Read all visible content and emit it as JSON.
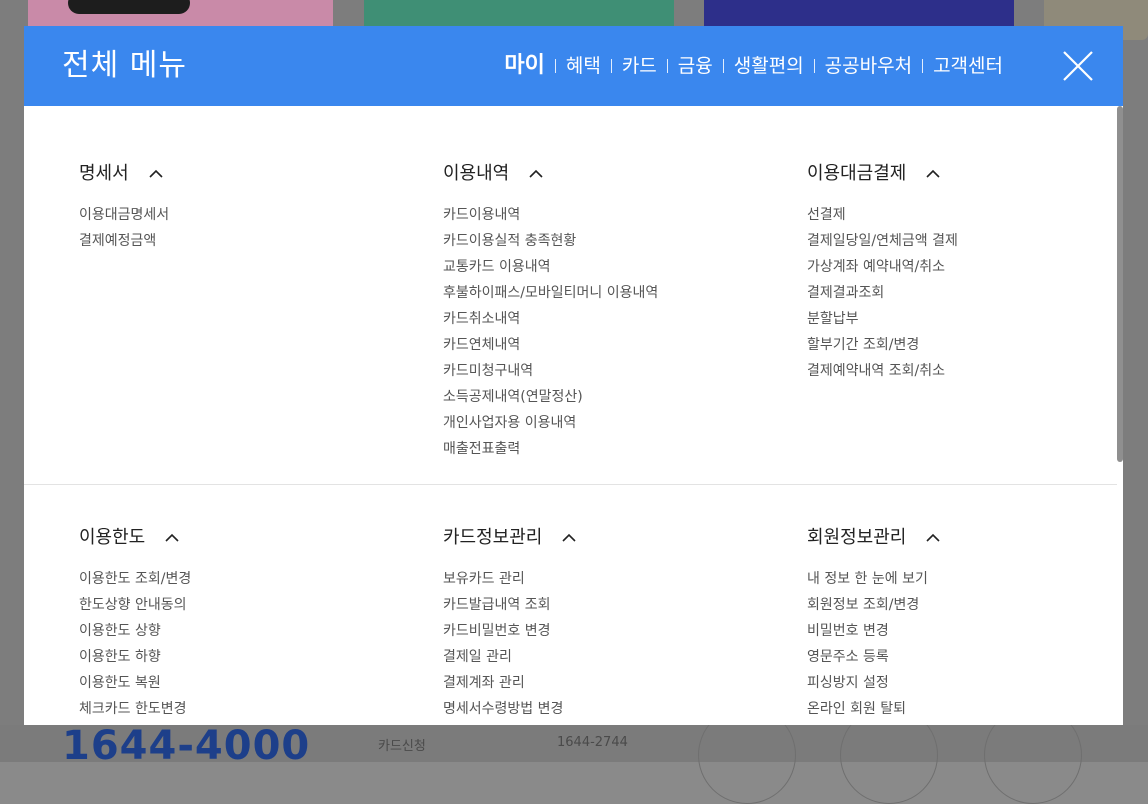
{
  "background": {
    "phone": "1644-4000",
    "mini_labels": [
      "카드신청",
      "1644-2744"
    ]
  },
  "menu": {
    "title": "전체 메뉴",
    "tabs": [
      {
        "label": "마이",
        "active": true
      },
      {
        "label": "혜택",
        "active": false
      },
      {
        "label": "카드",
        "active": false
      },
      {
        "label": "금융",
        "active": false
      },
      {
        "label": "생활편의",
        "active": false
      },
      {
        "label": "공공바우처",
        "active": false
      },
      {
        "label": "고객센터",
        "active": false
      }
    ],
    "close_icon": "close-icon",
    "sections": [
      {
        "title": "명세서",
        "items": [
          "이용대금명세서",
          "결제예정금액"
        ]
      },
      {
        "title": "이용내역",
        "items": [
          "카드이용내역",
          "카드이용실적 충족현황",
          "교통카드 이용내역",
          "후불하이패스/모바일티머니 이용내역",
          "카드취소내역",
          "카드연체내역",
          "카드미청구내역",
          "소득공제내역(연말정산)",
          "개인사업자용 이용내역",
          "매출전표출력"
        ]
      },
      {
        "title": "이용대금결제",
        "items": [
          "선결제",
          "결제일당일/연체금액 결제",
          "가상계좌 예약내역/취소",
          "결제결과조회",
          "분할납부",
          "할부기간 조회/변경",
          "결제예약내역 조회/취소"
        ]
      },
      {
        "title": "이용한도",
        "items": [
          "이용한도 조회/변경",
          "한도상향 안내동의",
          "이용한도 상향",
          "이용한도 하향",
          "이용한도 복원",
          "체크카드 한도변경"
        ]
      },
      {
        "title": "카드정보관리",
        "items": [
          "보유카드 관리",
          "카드발급내역 조회",
          "카드비밀번호 변경",
          "결제일 관리",
          "결제계좌 관리",
          "명세서수령방법 변경"
        ]
      },
      {
        "title": "회원정보관리",
        "items": [
          "내 정보 한 눈에 보기",
          "회원정보 조회/변경",
          "비밀번호 변경",
          "영문주소 등록",
          "피싱방지 설정",
          "온라인 회원 탈퇴"
        ]
      }
    ]
  },
  "colors": {
    "header_bg": "#3a87ee",
    "text_dark": "#222222",
    "text_item": "#555555"
  }
}
